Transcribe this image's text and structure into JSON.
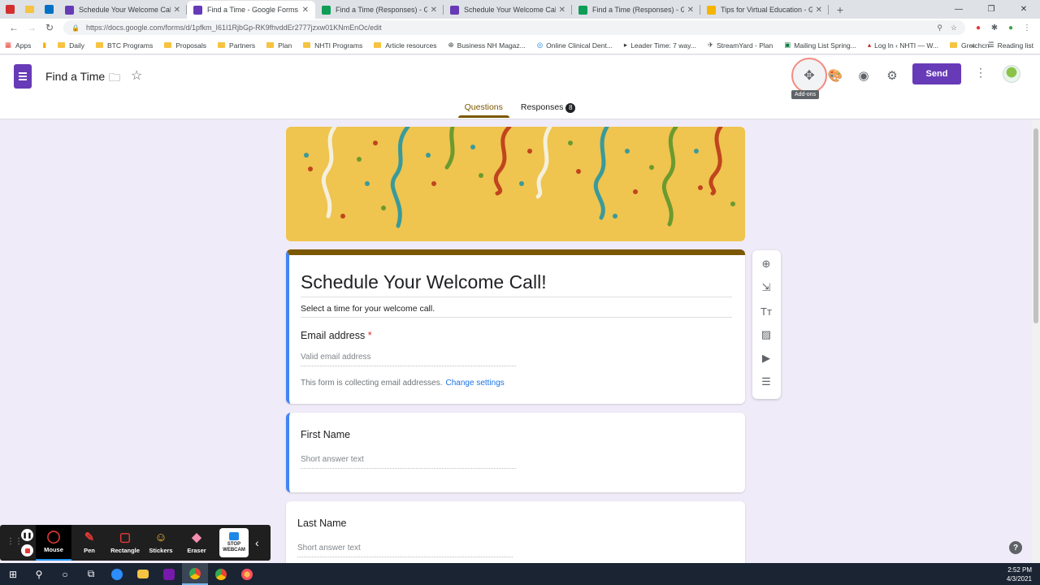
{
  "browser": {
    "tabs": [
      {
        "title": "Schedule Your Welcome Call!",
        "color": "#673ab7",
        "active": false
      },
      {
        "title": "Find a Time - Google Forms",
        "color": "#673ab7",
        "active": true
      },
      {
        "title": "Find a Time (Responses) - Googl...",
        "color": "#0f9d58",
        "active": false
      },
      {
        "title": "Schedule Your Welcome Call!",
        "color": "#673ab7",
        "active": false
      },
      {
        "title": "Find a Time (Responses) - Googl...",
        "color": "#0f9d58",
        "active": false
      },
      {
        "title": "Tips for Virtual Education - Goog...",
        "color": "#f4b400",
        "active": false
      }
    ],
    "url": "https://docs.google.com/forms/d/1pfkm_I61I1RjbGp-RK9fhvddEr2777jzxw01KNmEnOc/edit",
    "bookmarks": [
      "Apps",
      "Daily",
      "BTC Programs",
      "Proposals",
      "Partners",
      "Plan",
      "NHTI Programs",
      "Article resources",
      "Business NH Magaz...",
      "Online Clinical Dent...",
      "Leader Time: 7 way...",
      "StreamYard - Plan",
      "Mailing List Spring...",
      "Log In ‹ NHTI — W...",
      "Gretchcn"
    ],
    "reading_list": "Reading list"
  },
  "header": {
    "form_name": "Find a Time",
    "addons_tooltip": "Add-ons",
    "send_label": "Send",
    "tabs": {
      "questions": "Questions",
      "responses": "Responses",
      "responses_count": "8"
    }
  },
  "form": {
    "title": "Schedule Your Welcome Call!",
    "description": "Select a time for your welcome call.",
    "email": {
      "label": "Email address",
      "required_mark": "*",
      "placeholder": "Valid email address",
      "collecting_note": "This form is collecting email addresses.",
      "change_settings": "Change settings"
    },
    "questions": [
      {
        "label": "First Name",
        "placeholder": "Short answer text"
      },
      {
        "label": "Last Name",
        "placeholder": "Short answer text"
      }
    ]
  },
  "recorder": {
    "tools": [
      "Mouse",
      "Pen",
      "Rectangle",
      "Stickers",
      "Eraser"
    ],
    "webcam_label": "STOP WEBCAM"
  },
  "taskbar": {
    "time": "2:52 PM",
    "date": "4/3/2021"
  },
  "icons": {
    "help": "?"
  }
}
